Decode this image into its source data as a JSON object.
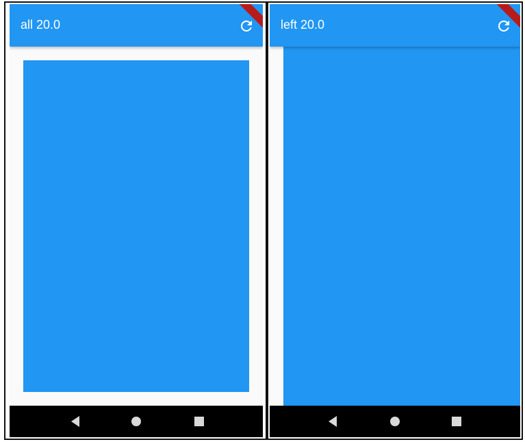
{
  "screens": [
    {
      "title": "all 20.0",
      "refresh_icon": "refresh-icon",
      "padding_mode": "all",
      "padding_value": 20.0
    },
    {
      "title": "left 20.0",
      "refresh_icon": "refresh-icon",
      "padding_mode": "left",
      "padding_value": 20.0
    }
  ],
  "navigation": {
    "back_icon": "back-triangle-icon",
    "home_icon": "home-circle-icon",
    "recents_icon": "recents-square-icon"
  },
  "colors": {
    "primary": "#2196F3",
    "background": "#FAFAFA",
    "navbar": "#000000",
    "debug_banner": "#B71C1C"
  }
}
